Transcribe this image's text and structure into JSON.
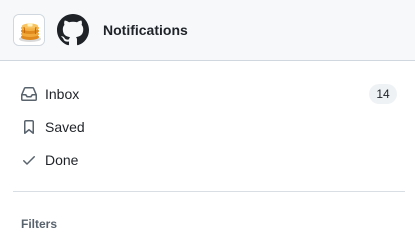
{
  "header": {
    "title": "Notifications",
    "avatar_icon": "pancakes-avatar-icon",
    "logo_icon": "github-mark-icon"
  },
  "nav": {
    "items": [
      {
        "label": "Inbox",
        "icon": "inbox-icon",
        "count": "14"
      },
      {
        "label": "Saved",
        "icon": "bookmark-icon"
      },
      {
        "label": "Done",
        "icon": "check-icon"
      }
    ]
  },
  "filters": {
    "heading": "Filters"
  },
  "colors": {
    "header_bg": "#f6f8fa",
    "border": "#d0d7de",
    "text": "#1f2328",
    "muted_text": "#59636e",
    "counter_bg": "#eff2f5"
  }
}
